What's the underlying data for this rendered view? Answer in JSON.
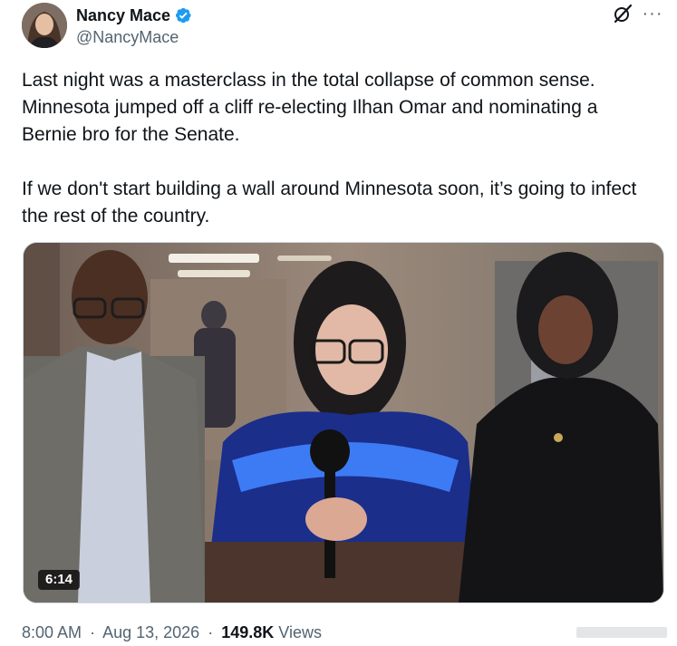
{
  "author": {
    "display_name": "Nancy Mace",
    "handle": "@NancyMace",
    "verified_icon": "verified-badge-icon"
  },
  "header_icons": {
    "grok": "grok-icon",
    "more": "more-options-icon",
    "more_glyph": "···"
  },
  "tweet": {
    "text": "Last night was a masterclass in the total collapse of common sense. Minnesota jumped off a cliff re-electing Ilhan Omar and nominating a Bernie bro for the Senate.\n\nIf we don't start building a wall around Minnesota soon, it’s going to infect the rest of the country."
  },
  "media": {
    "type": "video",
    "duration": "6:14"
  },
  "meta": {
    "time": "8:00 AM",
    "separator": "·",
    "date": "Aug 13, 2026",
    "views_count": "149.8K",
    "views_label": "Views"
  },
  "colors": {
    "text_primary": "#0f1419",
    "text_secondary": "#536471",
    "verified_blue": "#1d9bf0",
    "border": "#cfd9de"
  }
}
